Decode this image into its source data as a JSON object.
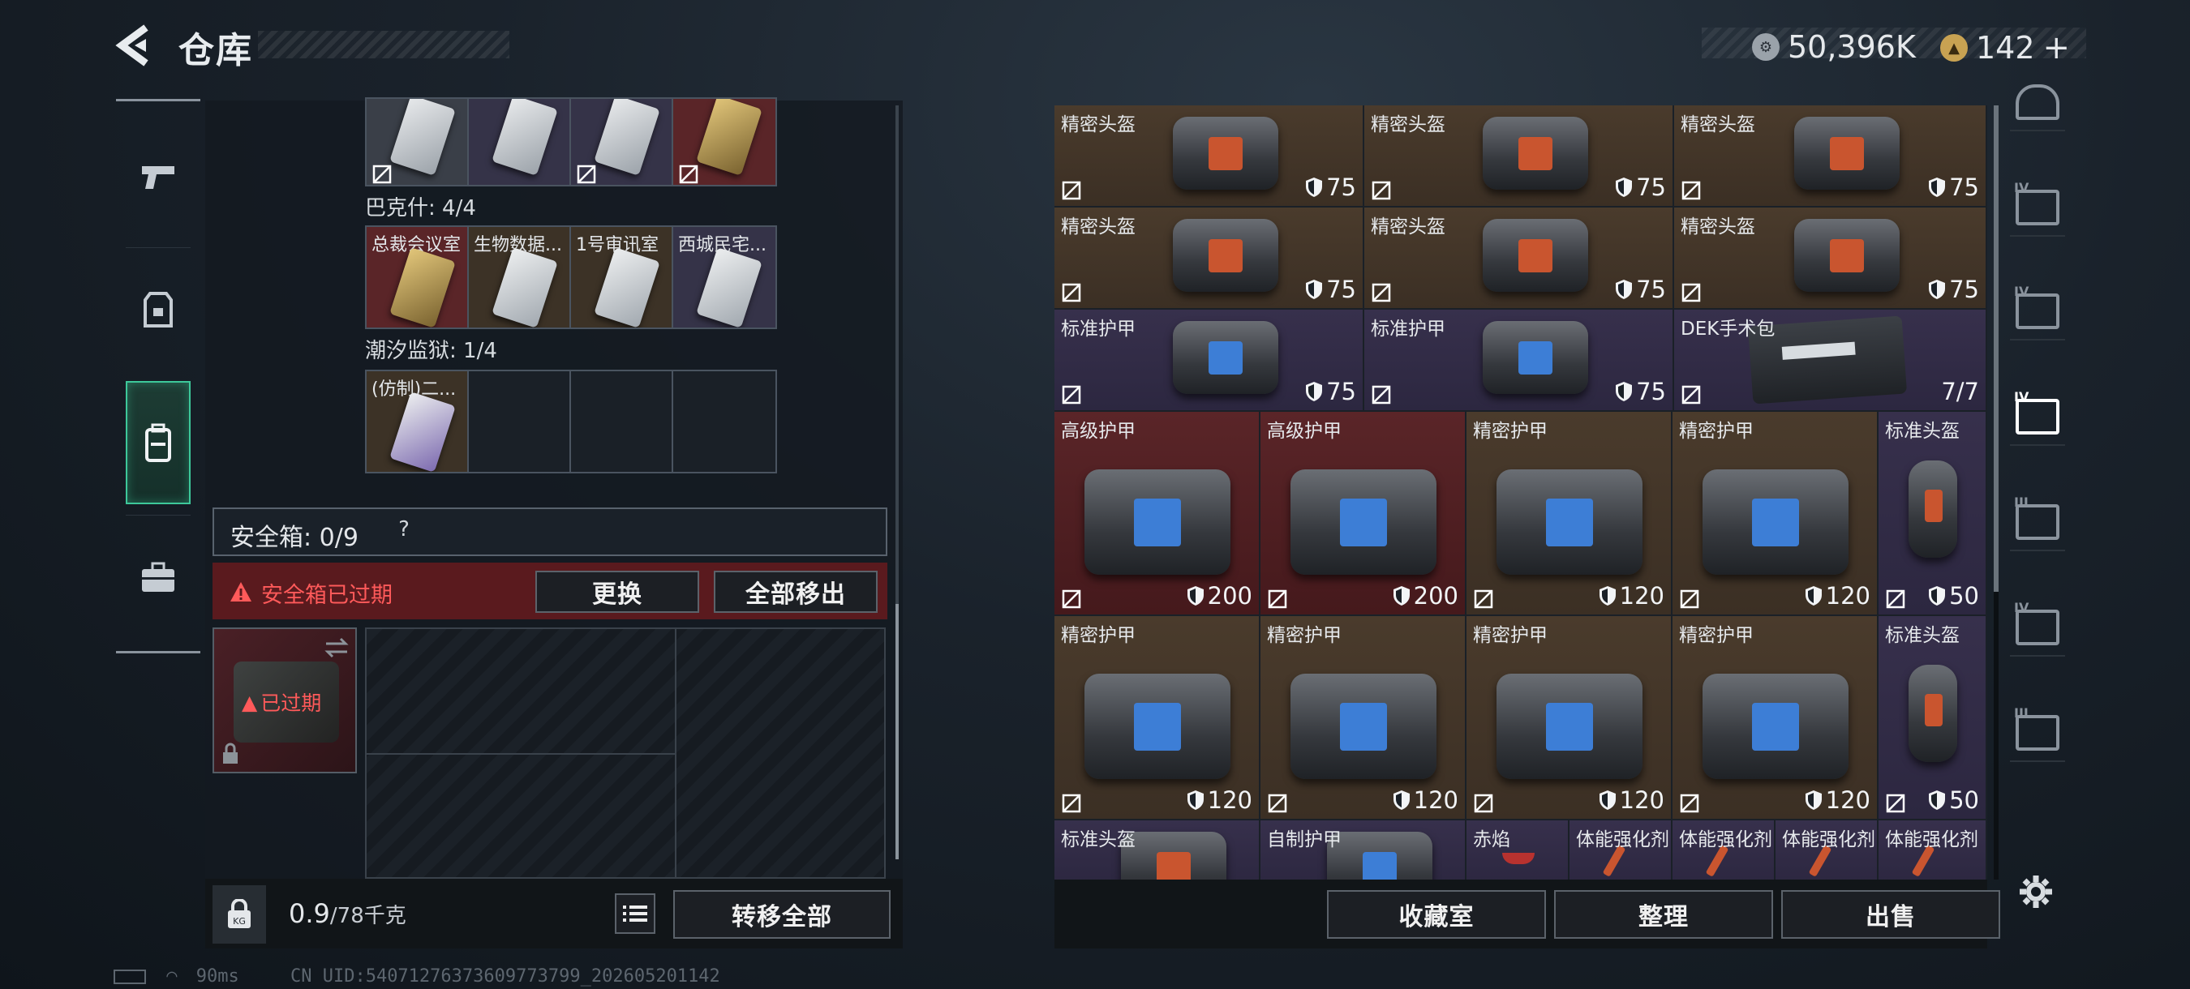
{
  "header": {
    "title": "仓库"
  },
  "currency": {
    "coins": "50,396K",
    "coupons": "142",
    "add": "+"
  },
  "left": {
    "cards_row1": [
      {
        "tint": "silver"
      },
      {
        "tint": "silver"
      },
      {
        "tint": "silver"
      },
      {
        "tint": "gold"
      }
    ],
    "section_bakshi": "巴克什: 4/4",
    "cards_row2": [
      {
        "label": "总裁会议室",
        "tint": "gold"
      },
      {
        "label": "生物数据...",
        "tint": "silver"
      },
      {
        "label": "1号审讯室",
        "tint": "silver"
      },
      {
        "label": "西城民宅...",
        "tint": "silver"
      }
    ],
    "section_tide": "潮汐监狱: 1/4",
    "cards_row3": [
      {
        "label": "(仿制)二...",
        "tint": "purple"
      }
    ],
    "safe_title": "安全箱: 0/9",
    "help": "?",
    "expired_msg": "安全箱已过期",
    "replace_btn": "更换",
    "remove_all_btn": "全部移出",
    "case_expired": "已过期",
    "weight_main": "0.9",
    "weight_unit": "/78千克",
    "transfer_all_btn": "转移全部"
  },
  "right": {
    "items": [
      {
        "name": "精密头盔",
        "durability": "75",
        "rarity": "brown",
        "kind": "helmet"
      },
      {
        "name": "精密头盔",
        "durability": "75",
        "rarity": "brown",
        "kind": "helmet"
      },
      {
        "name": "精密头盔",
        "durability": "75",
        "rarity": "brown",
        "kind": "helmet"
      },
      {
        "name": "精密头盔",
        "durability": "75",
        "rarity": "brown",
        "kind": "helmet"
      },
      {
        "name": "精密头盔",
        "durability": "75",
        "rarity": "brown",
        "kind": "helmet"
      },
      {
        "name": "精密头盔",
        "durability": "75",
        "rarity": "brown",
        "kind": "helmet"
      },
      {
        "name": "标准护甲",
        "durability": "75",
        "rarity": "purple",
        "kind": "armor"
      },
      {
        "name": "标准护甲",
        "durability": "75",
        "rarity": "purple",
        "kind": "armor"
      },
      {
        "name": "DEK手术包",
        "durability": "7/7",
        "rarity": "purple",
        "kind": "medkit"
      },
      {
        "name": "高级护甲",
        "durability": "200",
        "rarity": "red",
        "kind": "armor"
      },
      {
        "name": "高级护甲",
        "durability": "200",
        "rarity": "red",
        "kind": "armor"
      },
      {
        "name": "精密护甲",
        "durability": "120",
        "rarity": "brown",
        "kind": "armor"
      },
      {
        "name": "精密护甲",
        "durability": "120",
        "rarity": "brown",
        "kind": "armor"
      },
      {
        "name": "标准头盔",
        "durability": "50",
        "rarity": "purple",
        "kind": "helmet-side"
      },
      {
        "name": "精密护甲",
        "durability": "120",
        "rarity": "brown",
        "kind": "armor"
      },
      {
        "name": "精密护甲",
        "durability": "120",
        "rarity": "brown",
        "kind": "armor"
      },
      {
        "name": "精密护甲",
        "durability": "120",
        "rarity": "brown",
        "kind": "armor"
      },
      {
        "name": "精密护甲",
        "durability": "120",
        "rarity": "brown",
        "kind": "armor"
      },
      {
        "name": "标准头盔",
        "durability": "50",
        "rarity": "purple",
        "kind": "helmet-side"
      },
      {
        "name": "标准头盔",
        "rarity": "purple",
        "kind": "helmet"
      },
      {
        "name": "自制护甲",
        "rarity": "purple",
        "kind": "armor"
      },
      {
        "name": "赤焰",
        "rarity": "purple",
        "kind": "other"
      },
      {
        "name": "体能强化剂",
        "rarity": "purple",
        "kind": "syringe"
      },
      {
        "name": "体能强化剂",
        "rarity": "purple",
        "kind": "syringe"
      },
      {
        "name": "体能强化剂",
        "rarity": "purple",
        "kind": "syringe"
      },
      {
        "name": "体能强化剂",
        "rarity": "purple",
        "kind": "syringe"
      }
    ],
    "collection_btn": "收藏室",
    "sort_btn": "整理",
    "sell_btn": "出售"
  },
  "side_nav": [
    {
      "icon": "helmet-icon"
    },
    {
      "icon": "iv-armor-icon",
      "tier": "IV"
    },
    {
      "icon": "iv-folder-icon",
      "tier": "IV"
    },
    {
      "icon": "iv-medkit-icon",
      "tier": "IV"
    },
    {
      "icon": "iii-tool-icon",
      "tier": "III"
    },
    {
      "icon": "iv-gear-icon",
      "tier": "IV"
    },
    {
      "icon": "iii-map-icon",
      "tier": "III"
    }
  ],
  "footer": {
    "ping": "90ms",
    "uid": "CN UID:54071276373609773799_202605201142"
  },
  "colors": {
    "accent": "#3dc89a",
    "expired": "#ff5a5a",
    "brown": "#4a3b2c",
    "purple": "#37304c",
    "red": "#5a2528"
  }
}
